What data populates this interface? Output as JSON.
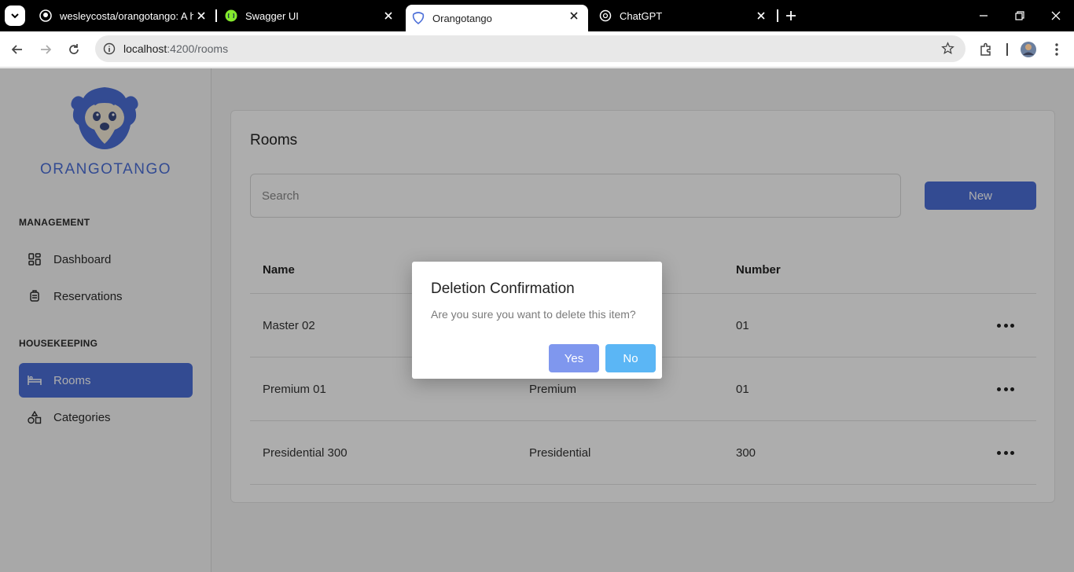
{
  "browser": {
    "tabs": [
      {
        "title": "wesleycosta/orangotango: A ho",
        "icon": "github-icon",
        "active": false
      },
      {
        "title": "Swagger UI",
        "icon": "swagger-icon",
        "active": false
      },
      {
        "title": "Orangotango",
        "icon": "orangotango-favicon",
        "active": true
      },
      {
        "title": "ChatGPT",
        "icon": "chatgpt-icon",
        "active": false
      }
    ],
    "url_host": "localhost",
    "url_path": ":4200/rooms"
  },
  "sidebar": {
    "brand": "ORANGOTANGO",
    "sections": [
      {
        "title": "MANAGEMENT",
        "items": [
          {
            "label": "Dashboard",
            "icon": "dashboard-icon",
            "active": false
          },
          {
            "label": "Reservations",
            "icon": "luggage-icon",
            "active": false
          }
        ]
      },
      {
        "title": "HOUSEKEEPING",
        "items": [
          {
            "label": "Rooms",
            "icon": "bed-icon",
            "active": true
          },
          {
            "label": "Categories",
            "icon": "shapes-icon",
            "active": false
          }
        ]
      }
    ]
  },
  "rooms": {
    "title": "Rooms",
    "search_placeholder": "Search",
    "new_label": "New",
    "columns": [
      "Name",
      "Number"
    ],
    "rows": [
      {
        "name": "Master 02",
        "category": "",
        "number": "01"
      },
      {
        "name": "Premium 01",
        "category": "Premium",
        "number": "01"
      },
      {
        "name": "Presidential 300",
        "category": "Presidential",
        "number": "300"
      }
    ]
  },
  "dialog": {
    "title": "Deletion Confirmation",
    "message": "Are you sure you want to delete this item?",
    "yes_label": "Yes",
    "no_label": "No"
  },
  "colors": {
    "accent": "#4c6fd8",
    "yes_button": "#7f97ee",
    "no_button": "#5bb6f5"
  }
}
